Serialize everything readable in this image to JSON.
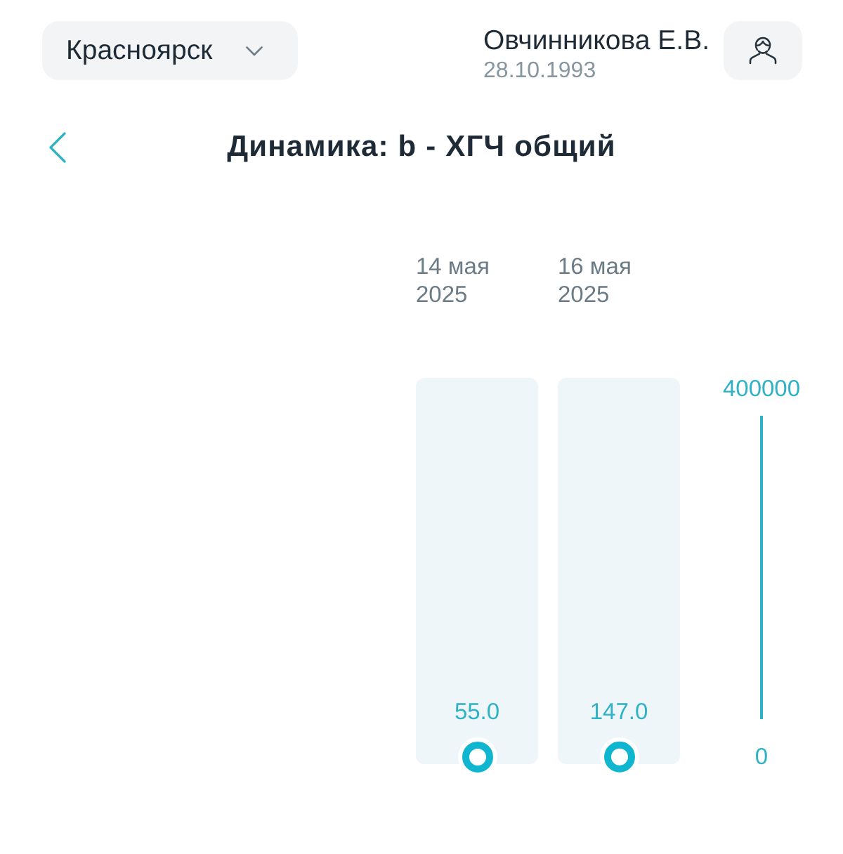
{
  "header": {
    "city": "Красноярск",
    "patient": {
      "name": "Овчинникова Е.В.",
      "birth_date": "28.10.1993"
    }
  },
  "title": "Динамика: b - ХГЧ общий",
  "chart": {
    "chart_data": {
      "type": "scatter",
      "categories": [
        "14 мая 2025",
        "16 мая 2025"
      ],
      "values": [
        55.0,
        147.0
      ],
      "ylim": [
        0,
        400000
      ],
      "yticks": [
        0,
        400000
      ],
      "value_labels": [
        "55.0",
        "147.0"
      ]
    }
  }
}
